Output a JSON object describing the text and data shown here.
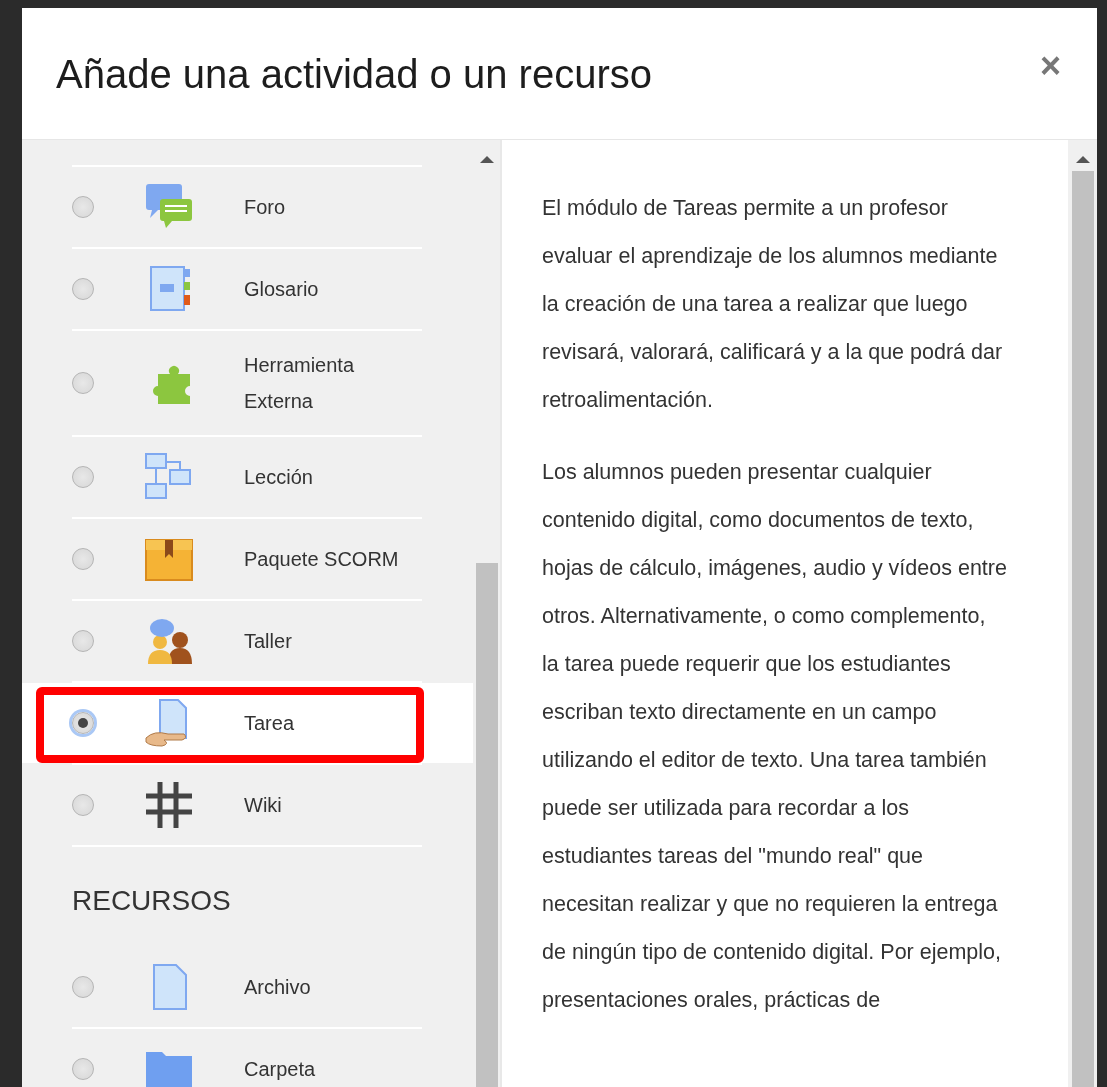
{
  "dialog": {
    "title": "Añade una actividad o un recurso",
    "close": "×"
  },
  "sections": [
    {
      "items": [
        {
          "label": "Foro",
          "selected": false
        },
        {
          "label": "Glosario",
          "selected": false
        },
        {
          "label": "Herramienta Externa",
          "selected": false
        },
        {
          "label": "Lección",
          "selected": false
        },
        {
          "label": "Paquete SCORM",
          "selected": false
        },
        {
          "label": "Taller",
          "selected": false
        },
        {
          "label": "Tarea",
          "selected": true,
          "highlighted": true
        },
        {
          "label": "Wiki",
          "selected": false
        }
      ]
    },
    {
      "heading": "RECURSOS",
      "items": [
        {
          "label": "Archivo",
          "selected": false
        },
        {
          "label": "Carpeta",
          "selected": false
        }
      ]
    }
  ],
  "description": [
    "El módulo de Tareas permite a un profesor evaluar el aprendizaje de los alumnos mediante la creación de una tarea a realizar que luego revisará, valorará, calificará y a la que podrá dar retroalimentación.",
    "Los alumnos pueden presentar cualquier contenido digital, como documentos de texto, hojas de cálculo, imágenes, audio y vídeos entre otros. Alternativamente, o como complemento, la tarea puede requerir que los estudiantes escriban texto directamente en un campo utilizando el editor de texto. Una tarea también puede ser utilizada para recordar a los estudiantes tareas del \"mundo real\" que necesitan realizar y que no requieren la entrega de ningún tipo de contenido digital. Por ejemplo, presentaciones orales, prácticas de"
  ]
}
